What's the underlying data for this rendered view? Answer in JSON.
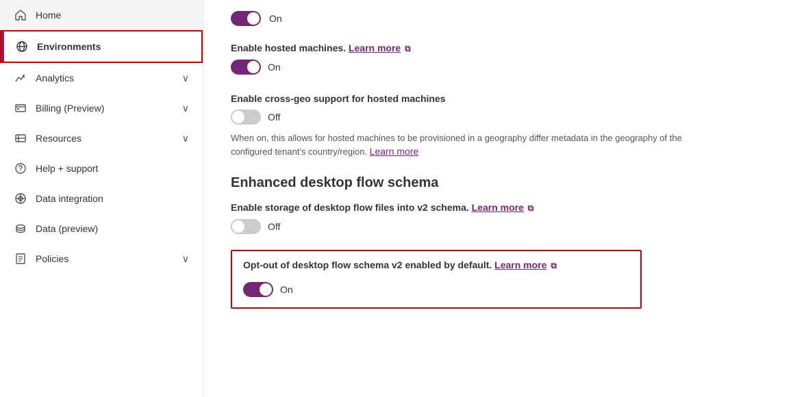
{
  "sidebar": {
    "items": [
      {
        "id": "home",
        "label": "Home",
        "icon": "home",
        "active": false,
        "has_chevron": false
      },
      {
        "id": "environments",
        "label": "Environments",
        "icon": "globe",
        "active": true,
        "has_chevron": false
      },
      {
        "id": "analytics",
        "label": "Analytics",
        "icon": "analytics",
        "active": false,
        "has_chevron": true
      },
      {
        "id": "billing",
        "label": "Billing (Preview)",
        "icon": "billing",
        "active": false,
        "has_chevron": true
      },
      {
        "id": "resources",
        "label": "Resources",
        "icon": "resources",
        "active": false,
        "has_chevron": true
      },
      {
        "id": "help",
        "label": "Help + support",
        "icon": "help",
        "active": false,
        "has_chevron": false
      },
      {
        "id": "data-integration",
        "label": "Data integration",
        "icon": "data-integration",
        "active": false,
        "has_chevron": false
      },
      {
        "id": "data-preview",
        "label": "Data (preview)",
        "icon": "data-preview",
        "active": false,
        "has_chevron": false
      },
      {
        "id": "policies",
        "label": "Policies",
        "icon": "policies",
        "active": false,
        "has_chevron": true
      }
    ]
  },
  "main": {
    "top_toggle": {
      "state": "on",
      "label": "On"
    },
    "hosted_machines": {
      "title": "Enable hosted machines.",
      "learn_more": "Learn more",
      "toggle_state": "on",
      "toggle_label": "On"
    },
    "cross_geo": {
      "title": "Enable cross-geo support for hosted machines",
      "toggle_state": "off",
      "toggle_label": "Off",
      "description": "When on, this allows for hosted machines to be provisioned in a geography differ\nmetadata in the geography of the configured tenant's country/region.",
      "learn_more": "Learn more"
    },
    "enhanced_schema": {
      "heading": "Enhanced desktop flow schema",
      "storage_setting": {
        "title": "Enable storage of desktop flow files into v2 schema.",
        "learn_more": "Learn more",
        "toggle_state": "off",
        "toggle_label": "Off"
      },
      "opt_out_setting": {
        "title": "Opt-out of desktop flow schema v2 enabled by default.",
        "learn_more": "Learn more",
        "toggle_state": "on",
        "toggle_label": "On"
      }
    }
  },
  "icons": {
    "home": "⌂",
    "globe": "🌐",
    "chevron_down": "∨",
    "external_link": "↗"
  }
}
